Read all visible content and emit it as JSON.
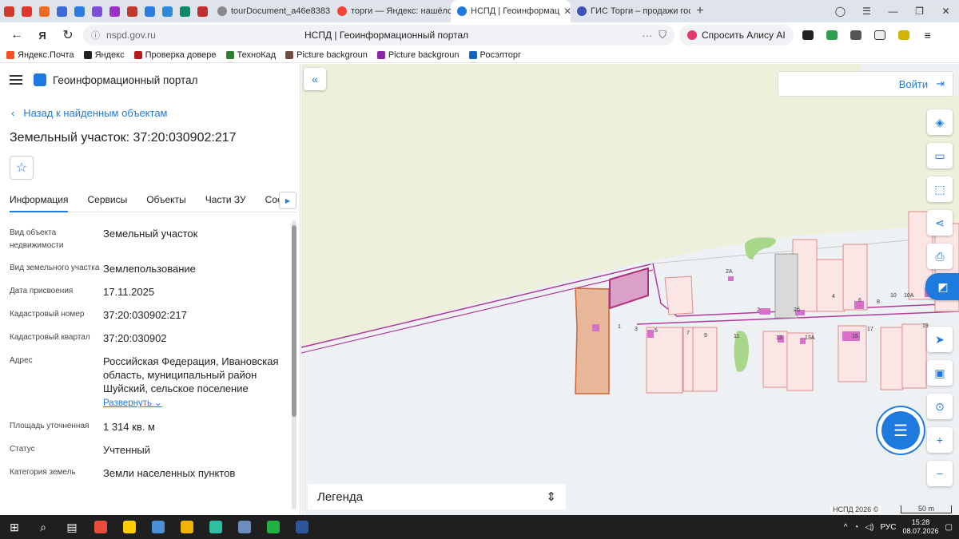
{
  "browser": {
    "pinned_colors": [
      "#d23a2f",
      "#e0332b",
      "#f26a22",
      "#3e6bd8",
      "#2b7de1",
      "#7b4fd6",
      "#9d2fc9",
      "#c0392b",
      "#2b7de1",
      "#2c8bd8",
      "#0a8a6a",
      "#c03030"
    ],
    "tabs": [
      {
        "label": "tourDocument_a46e8383",
        "color": "#8a8a8a"
      },
      {
        "label": "торги — Яндекс: нашёлся",
        "color": "#f44336"
      },
      {
        "label": "НСПД | Геоинформац",
        "color": "#1f7ae0",
        "active": true
      },
      {
        "label": "ГИС Торги – продажи гос",
        "color": "#3f51b5"
      }
    ],
    "close_glyph": "✕",
    "new_tab": "+",
    "window_controls": [
      "◯",
      "☰",
      "—",
      "❐",
      "✕"
    ],
    "url": "nspd.gov.ru",
    "page_title": "НСПД | Геоинформационный портал",
    "alice": "Спросить Алису AI",
    "bookmarks": [
      {
        "label": "Яндекс.Почта",
        "color": "#f4511e"
      },
      {
        "label": "Яндекс",
        "color": "#222"
      },
      {
        "label": "Проверка довере",
        "color": "#b71c1c"
      },
      {
        "label": "ТехноКад",
        "color": "#2e7d32"
      },
      {
        "label": "Picture backgroun",
        "color": "#6d4c41"
      },
      {
        "label": "Picture backgroun",
        "color": "#8e24aa"
      },
      {
        "label": "Росэлторг",
        "color": "#1565c0"
      }
    ]
  },
  "panel": {
    "portal_title": "Геоинформационный портал",
    "back": "Назад к найденным объектам",
    "object_title": "Земельный участок: 37:20:030902:217",
    "star": "☆",
    "tabs": [
      "Информация",
      "Сервисы",
      "Объекты",
      "Части ЗУ",
      "Состав"
    ],
    "tab_next": "▶",
    "properties": [
      {
        "key": "Вид объекта недвижимости",
        "value": "Земельный участок"
      },
      {
        "key": "Вид земельного участка",
        "value": "Землепользование"
      },
      {
        "key": "Дата присвоения",
        "value": "17.11.2025"
      },
      {
        "key": "Кадастровый номер",
        "value": "37:20:030902:217"
      },
      {
        "key": "Кадастровый квартал",
        "value": "37:20:030902"
      },
      {
        "key": "Адрес",
        "value": "Российская Федерация, Ивановская область, муниципальный район Шуйский, сельское поселение"
      },
      {
        "key": "Площадь уточненная",
        "value": "1 314 кв. м"
      },
      {
        "key": "Статус",
        "value": "Учтенный"
      },
      {
        "key": "Категория земель",
        "value": "Земли населенных пунктов"
      }
    ],
    "expand": "Развернуть"
  },
  "map": {
    "collapse": "«",
    "login": "Войти",
    "login_icon": "⇥",
    "legend": "Легенда",
    "legend_icon": "⇕",
    "copyright": "НСПД 2026 ©",
    "scale": "50 m",
    "zoom_in": "+",
    "zoom_out": "−",
    "parcel_labels": [
      "2А",
      "2",
      "2б",
      "4",
      "6",
      "8",
      "10",
      "10А",
      "1",
      "3",
      "5",
      "7",
      "9",
      "11",
      "13",
      "13А",
      "15",
      "17",
      "19"
    ]
  },
  "taskbar": {
    "lang": "РУС",
    "time": "15:28",
    "date": "08.07.2026",
    "apps": [
      "#e74c3c",
      "#ffcc00",
      "#4a90d9",
      "#f0b400",
      "#2dbf9f",
      "#6c8ebf",
      "#1fb141",
      "#2b579a"
    ]
  }
}
